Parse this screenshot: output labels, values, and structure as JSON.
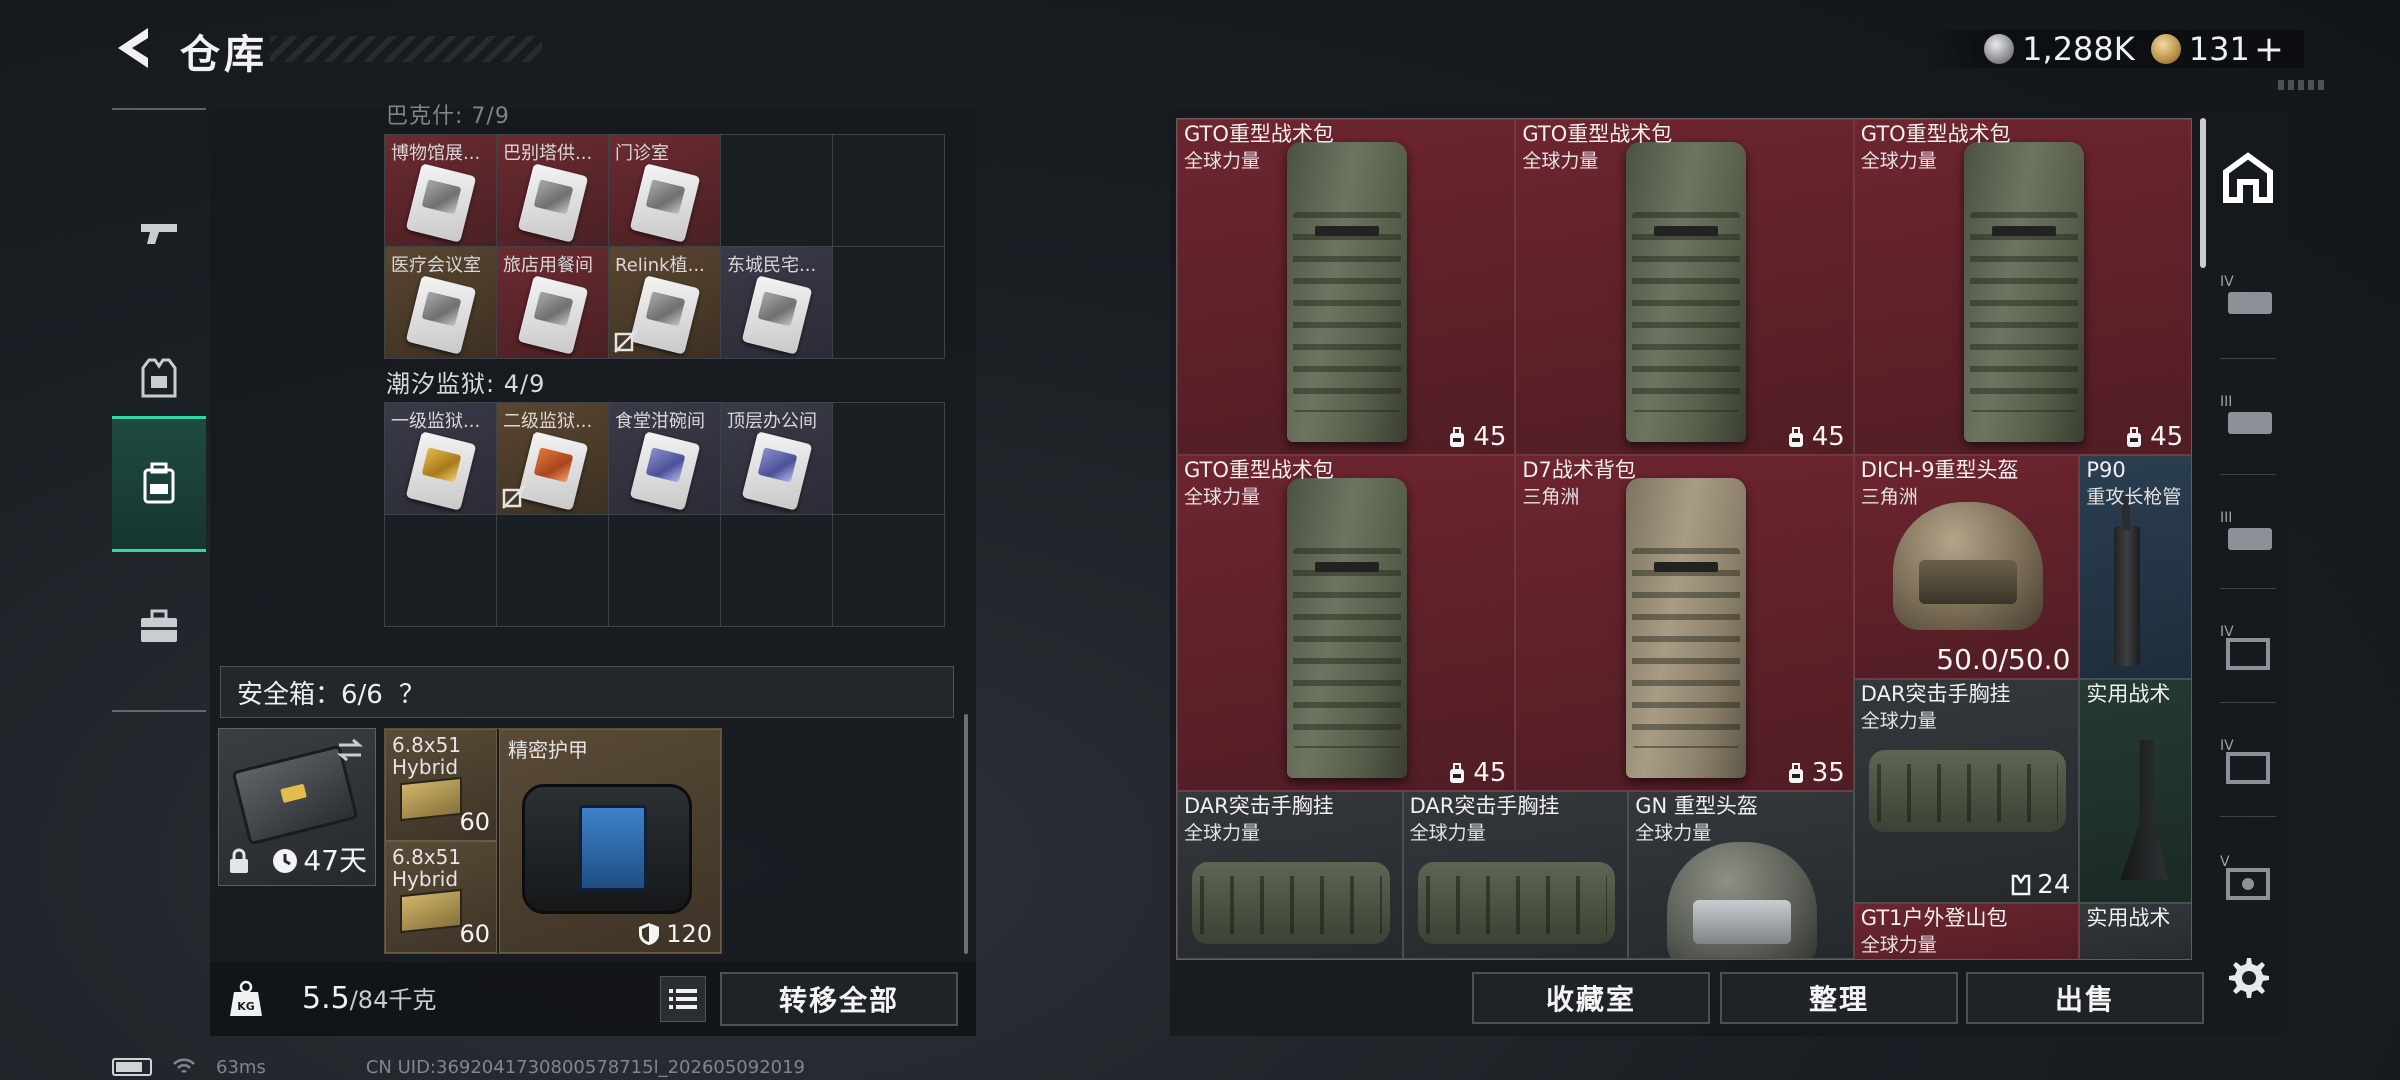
{
  "header": {
    "title": "仓库",
    "currency": {
      "silver": "1,288K",
      "gold": "131",
      "gold_plus": "+"
    }
  },
  "side_nav": [
    "weapons",
    "armor",
    "storage",
    "toolbox"
  ],
  "stash": {
    "group1_header": "巴克什: 7/9",
    "group1_items": [
      {
        "label": "博物馆展...",
        "style": "card",
        "card": ""
      },
      {
        "label": "巴别塔供...",
        "style": "card",
        "card": ""
      },
      {
        "label": "门诊室",
        "style": "card",
        "card": ""
      },
      {
        "label": "",
        "style": "empty",
        "card": "none"
      },
      {
        "label": "",
        "style": "empty",
        "card": "none"
      },
      {
        "label": "医疗会议室",
        "style": "card gold",
        "card": ""
      },
      {
        "label": "旅店用餐间",
        "style": "card",
        "card": ""
      },
      {
        "label": "Relink植...",
        "style": "card gold",
        "card": "",
        "marked": true
      },
      {
        "label": "东城民宅...",
        "style": "card pale",
        "card": ""
      }
    ],
    "group2_header": "潮汐监狱: 4/9",
    "group2_items": [
      {
        "label": "一级监狱...",
        "style": "card pale",
        "card": "yellow"
      },
      {
        "label": "二级监狱...",
        "style": "card gold",
        "card": "orange",
        "marked": true
      },
      {
        "label": "食堂泔碗间",
        "style": "card pale",
        "card": "blue"
      },
      {
        "label": "顶层办公间",
        "style": "card pale",
        "card": "blue"
      }
    ]
  },
  "safebox": {
    "title": "安全箱：6/6",
    "help": "？",
    "case_days": "47天",
    "ammo1": {
      "label": "6.8x51\nHybrid",
      "count": "60"
    },
    "ammo2": {
      "label": "6.8x51\nHybrid",
      "count": "60"
    },
    "armor": {
      "label": "精密护甲",
      "value": "120"
    }
  },
  "bottom_bar": {
    "weight": "5.5",
    "weight_max": "/84千克",
    "transfer_label": "转移全部"
  },
  "container": {
    "items": [
      {
        "name": "GTO重型战术包",
        "sub": "全球力量",
        "count": "45"
      },
      {
        "name": "GTO重型战术包",
        "sub": "全球力量",
        "count": "45"
      },
      {
        "name": "GTO重型战术包",
        "sub": "全球力量",
        "count": "45"
      },
      {
        "name": "GTO重型战术包",
        "sub": "全球力量",
        "count": "45"
      },
      {
        "name": "D7战术背包",
        "sub": "三角洲",
        "count": "35"
      },
      {
        "name": "DICH-9重型头盔",
        "sub": "三角洲",
        "count": "50.0/50.0"
      },
      {
        "name": "P90",
        "sub": "重攻长枪管",
        "count": ""
      },
      {
        "name": "DAR突击手胸挂",
        "sub": "全球力量",
        "count": "24"
      },
      {
        "name": "实用战术",
        "sub": "",
        "count": ""
      },
      {
        "name": "DAR突击手胸挂",
        "sub": "全球力量",
        "count": ""
      },
      {
        "name": "DAR突击手胸挂",
        "sub": "全球力量",
        "count": ""
      },
      {
        "name": "GN 重型头盔",
        "sub": "全球力量",
        "count": ""
      },
      {
        "name": "GT1户外登山包",
        "sub": "全球力量",
        "count": ""
      },
      {
        "name": "实用战术",
        "sub": "",
        "count": ""
      }
    ],
    "buttons": {
      "collection": "收藏室",
      "sort": "整理",
      "sell": "出售"
    }
  },
  "category_rail": [
    "home",
    "IV",
    "III",
    "III",
    "IV",
    "IV",
    "V"
  ],
  "footer": {
    "ping": "63ms",
    "uid": "CN UID:3692041730800578715l_202605092019"
  }
}
